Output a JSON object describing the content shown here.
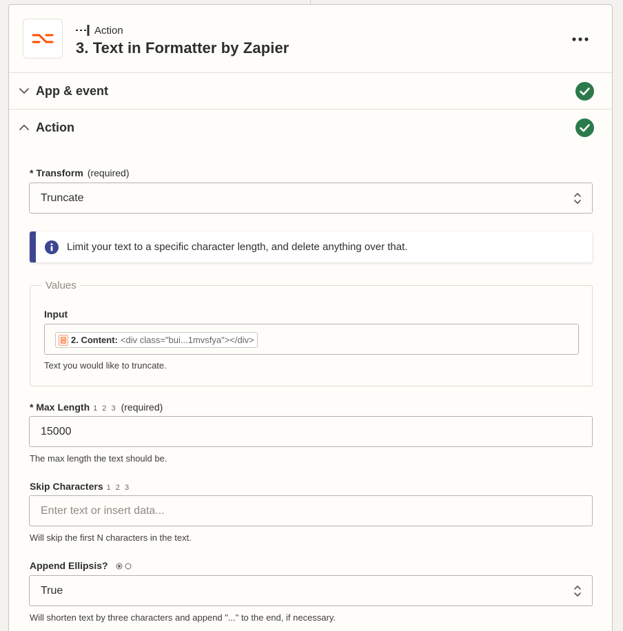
{
  "header": {
    "step_kind": "Action",
    "step_title": "3. Text in Formatter by Zapier"
  },
  "sections": {
    "app_event": "App & event",
    "action": "Action"
  },
  "transform": {
    "label": "Transform",
    "required": "(required)",
    "value": "Truncate"
  },
  "info": {
    "text": "Limit your text to a specific character length, and delete anything over that."
  },
  "values_group": {
    "legend": "Values",
    "input_label": "Input",
    "pill_key": "2. Content:",
    "pill_value": "<div class=\"bui...1mvsfya\"></div>",
    "help": "Text you would like to truncate."
  },
  "max_length": {
    "label": "Max Length",
    "types": "1 2 3",
    "required": "(required)",
    "value": "15000",
    "help": "The max length the text should be."
  },
  "skip_characters": {
    "label": "Skip Characters",
    "types": "1 2 3",
    "placeholder": "Enter text or insert data...",
    "help": "Will skip the first N characters in the text."
  },
  "append_ellipsis": {
    "label": "Append Ellipsis?",
    "value": "True",
    "help": "Will shorten text by three characters and append \"...\" to the end, if necessary."
  },
  "colors": {
    "brand": "#ff4f00",
    "success": "#2b7a4b",
    "info": "#3d4592"
  },
  "icons": [
    "formatter-logo-icon",
    "action-step-icon",
    "more-options-icon",
    "chevron-down-icon",
    "chevron-up-icon",
    "check-circle-icon",
    "up-down-icon",
    "info-icon",
    "webhook-app-icon",
    "radio-icon"
  ]
}
